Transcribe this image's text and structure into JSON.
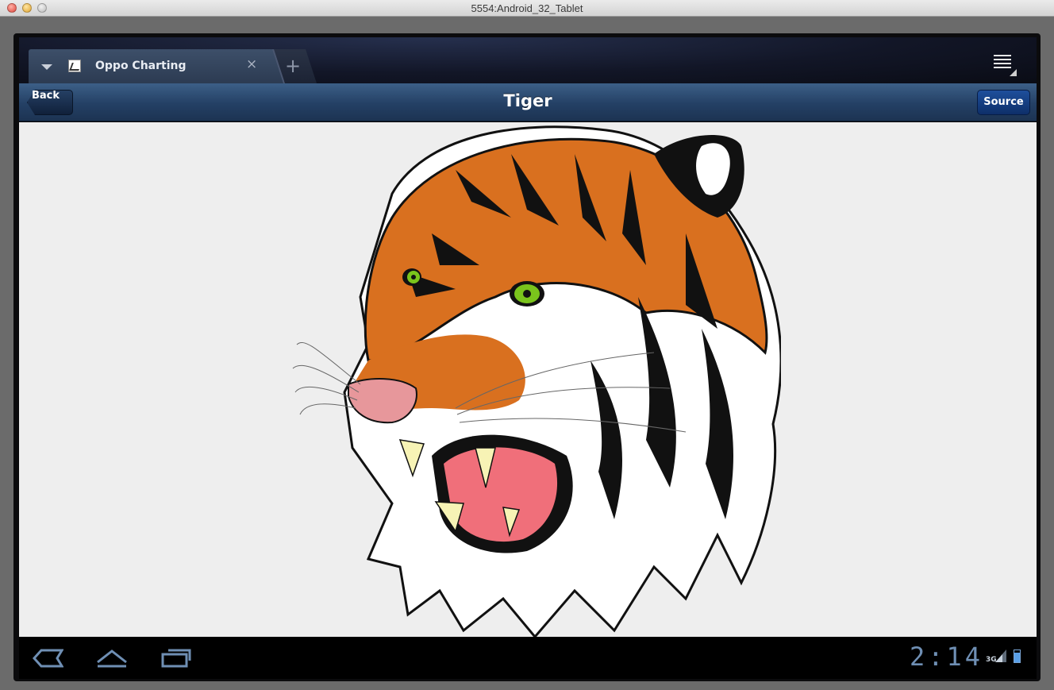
{
  "window": {
    "title": "5554:Android_32_Tablet"
  },
  "browser": {
    "tab": {
      "title": "Oppo Charting"
    },
    "new_tab_symbol": "+",
    "close_symbol": "×"
  },
  "navbar": {
    "back_label": "Back",
    "title": "Tiger",
    "source_label": "Source"
  },
  "content": {
    "image": "tiger-head-illustration"
  },
  "system_bar": {
    "time": "2:14",
    "network": "3G"
  },
  "colors": {
    "navbar": "#244065",
    "source_button": "#1e4f9c",
    "content_bg": "#eeeeee",
    "tiger_orange": "#d9701f",
    "tiger_eye": "#7ac41c"
  }
}
